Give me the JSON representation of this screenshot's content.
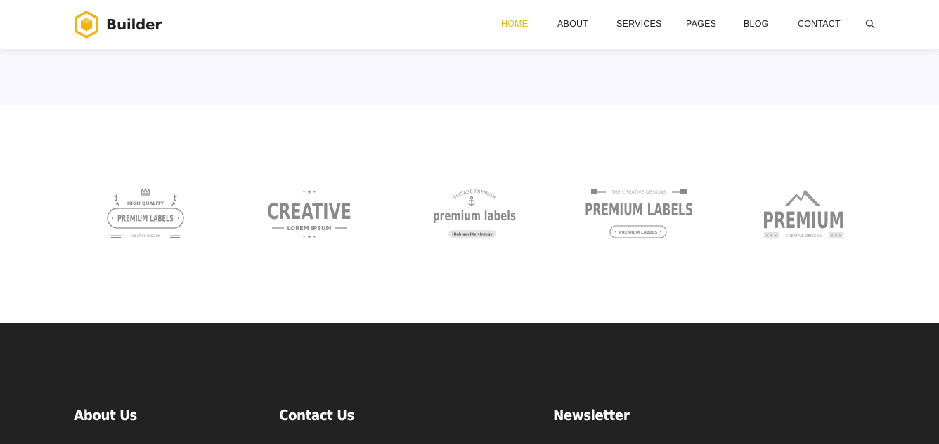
{
  "brand": {
    "name": "Builder",
    "accent": "#f3b30f",
    "icon": "cube-logo-icon"
  },
  "nav": {
    "items": [
      {
        "label": "HOME",
        "active": true
      },
      {
        "label": "ABOUT",
        "active": false
      },
      {
        "label": "SERVICES",
        "active": false
      },
      {
        "label": "PAGES",
        "active": false
      },
      {
        "label": "BLOG",
        "active": false
      },
      {
        "label": "CONTACT",
        "active": false
      }
    ],
    "search_icon": "search-icon"
  },
  "clients": [
    {
      "top": "HIGH QUALITY",
      "main": "PREMIUM LABELS",
      "bottom": "CREATIVE PASSION",
      "icon": "crown-icon"
    },
    {
      "main": "CREATIVE",
      "sub": "LOREM IPSUM"
    },
    {
      "top": "VINTAGE PREMIUM",
      "main": "premium labels",
      "bottom": "High quality vintage",
      "icon": "anchor-icon"
    },
    {
      "top": "THE CREATIVE DESIGNS",
      "main": "PREMIUM LABELS",
      "bottom": "PREMIUM LABELS"
    },
    {
      "main": "PREMIUM",
      "bottom": "CREATIVE DESIGNS",
      "icon": "mountain-icon"
    }
  ],
  "footer": {
    "about_title": "About Us",
    "contact_title": "Contact Us",
    "newsletter_title": "Newsletter",
    "background": "#222222"
  }
}
